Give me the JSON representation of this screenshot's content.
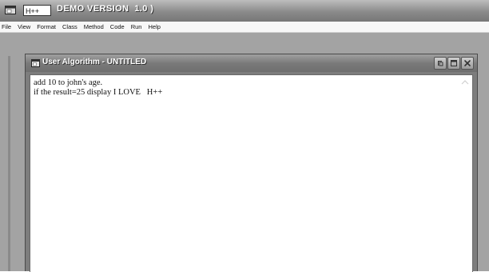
{
  "app": {
    "name_box": "H++",
    "title": "DEMO VERSION  1.0 )"
  },
  "menu": {
    "items": [
      "File",
      "View",
      "Format",
      "Class",
      "Method",
      "Code",
      "Run",
      "Help"
    ]
  },
  "editor_window": {
    "title": "User Algorithm - UNTITLED",
    "controls": [
      "restore-icon",
      "maximize-icon",
      "close-icon"
    ],
    "lines": [
      "add 10 to john's age.",
      "if the result=25 display I LOVE   H++"
    ]
  },
  "colors": {
    "titlebar": "#8a8a8a",
    "desktop": "#a3a3a3",
    "editor_bg": "#ffffff"
  }
}
